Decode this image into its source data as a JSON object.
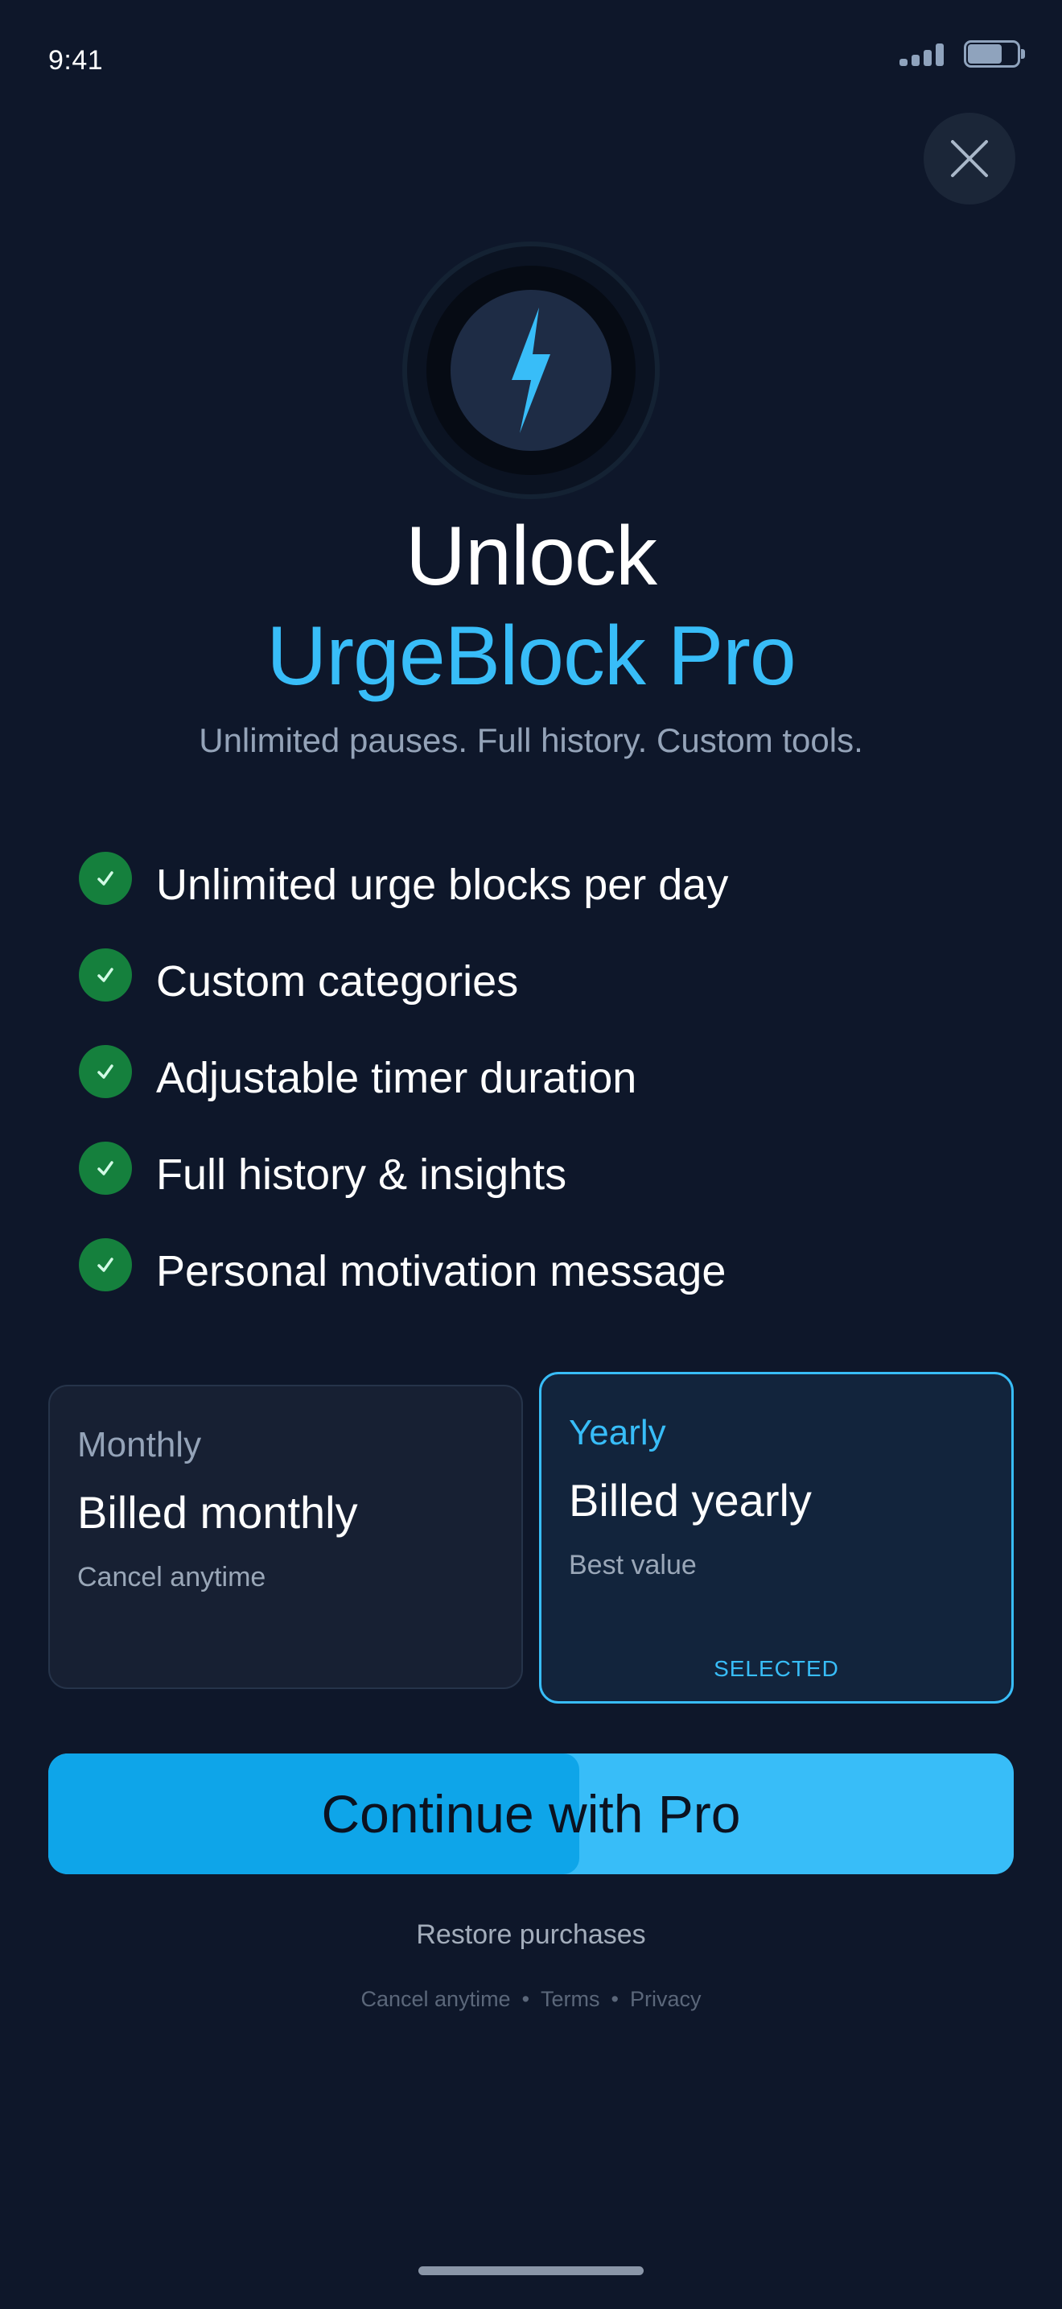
{
  "status_bar": {
    "time": "9:41"
  },
  "close": {
    "icon": "close-icon"
  },
  "hero": {
    "icon": "lightning-bolt-icon",
    "accent": "#38bdf8"
  },
  "header": {
    "title_line1": "Unlock",
    "title_line2": "UrgeBlock Pro",
    "subtitle": "Unlimited pauses. Full history. Custom tools."
  },
  "features": [
    {
      "label": "Unlimited urge blocks per day"
    },
    {
      "label": "Custom categories"
    },
    {
      "label": "Adjustable timer duration"
    },
    {
      "label": "Full history & insights"
    },
    {
      "label": "Personal motivation message"
    }
  ],
  "plans": {
    "monthly": {
      "name": "Monthly",
      "title": "Billed monthly",
      "note": "Cancel anytime"
    },
    "yearly": {
      "name": "Yearly",
      "title": "Billed yearly",
      "note": "Best value",
      "badge": "SELECTED"
    }
  },
  "cta": {
    "label": "Continue with Pro"
  },
  "restore": {
    "label": "Restore purchases"
  },
  "legal": {
    "cancel": "Cancel anytime",
    "separator": "•",
    "terms": "Terms",
    "privacy": "Privacy"
  },
  "colors": {
    "background": "#0e172a",
    "accent": "#38bdf8",
    "check": "#15803d",
    "cta_pressed": "#0ea5e9"
  }
}
